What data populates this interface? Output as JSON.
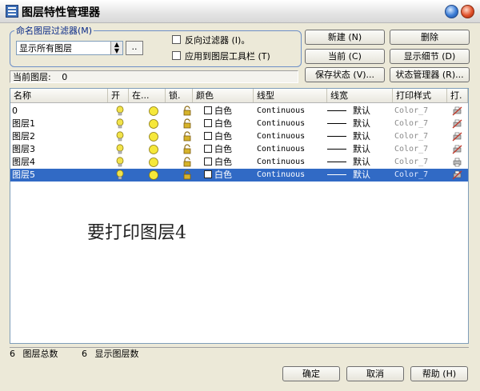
{
  "window": {
    "title": "图层特性管理器"
  },
  "filter": {
    "group_label": "命名图层过滤器",
    "group_mnemonic": "(M)",
    "selected": "显示所有图层",
    "dots_label": "..",
    "reverse_label": "反向过滤器 (I)。",
    "apply_toolbar_label": "应用到图层工具栏 (T)"
  },
  "buttons": {
    "new": "新建 (N)",
    "delete": "删除",
    "current": "当前 (C)",
    "show_details": "显示细节 (D)",
    "save_state": "保存状态 (V)...",
    "state_manager": "状态管理器 (R)...",
    "ok": "确定",
    "cancel": "取消",
    "help": "帮助 (H)"
  },
  "current_layer": {
    "label": "当前图层:",
    "value": "0"
  },
  "columns": [
    "名称",
    "开",
    "在...",
    "锁.",
    "颜色",
    "线型",
    "线宽",
    "打印样式",
    "打."
  ],
  "layers": [
    {
      "name": "0",
      "color": "白色",
      "linetype": "Continuous",
      "lineweight": "默认",
      "plot_style": "Color_7",
      "plot": "no-plot-icon",
      "selected": false
    },
    {
      "name": "图层1",
      "color": "白色",
      "linetype": "Continuous",
      "lineweight": "默认",
      "plot_style": "Color_7",
      "plot": "no-plot-icon",
      "selected": false
    },
    {
      "name": "图层2",
      "color": "白色",
      "linetype": "Continuous",
      "lineweight": "默认",
      "plot_style": "Color_7",
      "plot": "no-plot-icon",
      "selected": false
    },
    {
      "name": "图层3",
      "color": "白色",
      "linetype": "Continuous",
      "lineweight": "默认",
      "plot_style": "Color_7",
      "plot": "no-plot-icon",
      "selected": false
    },
    {
      "name": "图层4",
      "color": "白色",
      "linetype": "Continuous",
      "lineweight": "默认",
      "plot_style": "Color_7",
      "plot": "printer-icon",
      "selected": false
    },
    {
      "name": "图层5",
      "color": "白色",
      "linetype": "Continuous",
      "lineweight": "默认",
      "plot_style": "Color_7",
      "plot": "no-plot-icon",
      "selected": true
    }
  ],
  "annotation": "要打印图层4",
  "footer": {
    "total_count": "6",
    "total_label": "图层总数",
    "shown_count": "6",
    "shown_label": "显示图层数"
  },
  "colors": {
    "selection": "#316ac5",
    "bulb": "#f2e34a",
    "sun": "#f6e83a",
    "lock": "#d6b32a",
    "no_plot": "#c0392b"
  }
}
